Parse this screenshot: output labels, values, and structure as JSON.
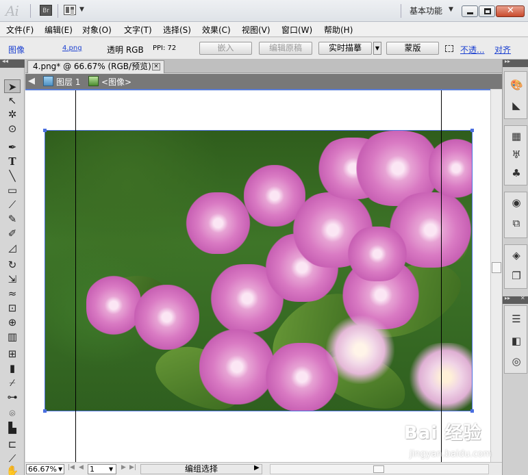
{
  "app": {
    "logo_text": "Ai",
    "bridge_label": "Br",
    "workspace_label": "基本功能"
  },
  "menu": [
    {
      "label": "文件(F)"
    },
    {
      "label": "编辑(E)"
    },
    {
      "label": "对象(O)"
    },
    {
      "label": "文字(T)"
    },
    {
      "label": "选择(S)"
    },
    {
      "label": "效果(C)"
    },
    {
      "label": "视图(V)"
    },
    {
      "label": "窗口(W)"
    },
    {
      "label": "帮助(H)"
    }
  ],
  "control_bar": {
    "object_type": "图像",
    "file_link": "4.png",
    "color_mode": "透明 RGB",
    "ppi": "PPI: 72",
    "embed_label": "嵌入",
    "edit_original_label": "编辑原稿",
    "live_trace_label": "实时描摹",
    "mask_label": "蒙版",
    "opacity_link": "不透...",
    "align_link": "对齐"
  },
  "document": {
    "tab_title": "4.png* @ 66.67% (RGB/预览)",
    "tab_close": "×",
    "layer_label": "图层 1",
    "object_label": "<图像>"
  },
  "status": {
    "zoom": "66.67%",
    "page": "1",
    "status_text": "编组选择"
  },
  "watermark": {
    "logo": "Bai 经验",
    "url": "jingyan.baidu.com"
  },
  "colors": {
    "selection_blue": "#4a6fe0",
    "menu_bg": "#f0f0f0",
    "flower_pink": "#d97ac3"
  }
}
